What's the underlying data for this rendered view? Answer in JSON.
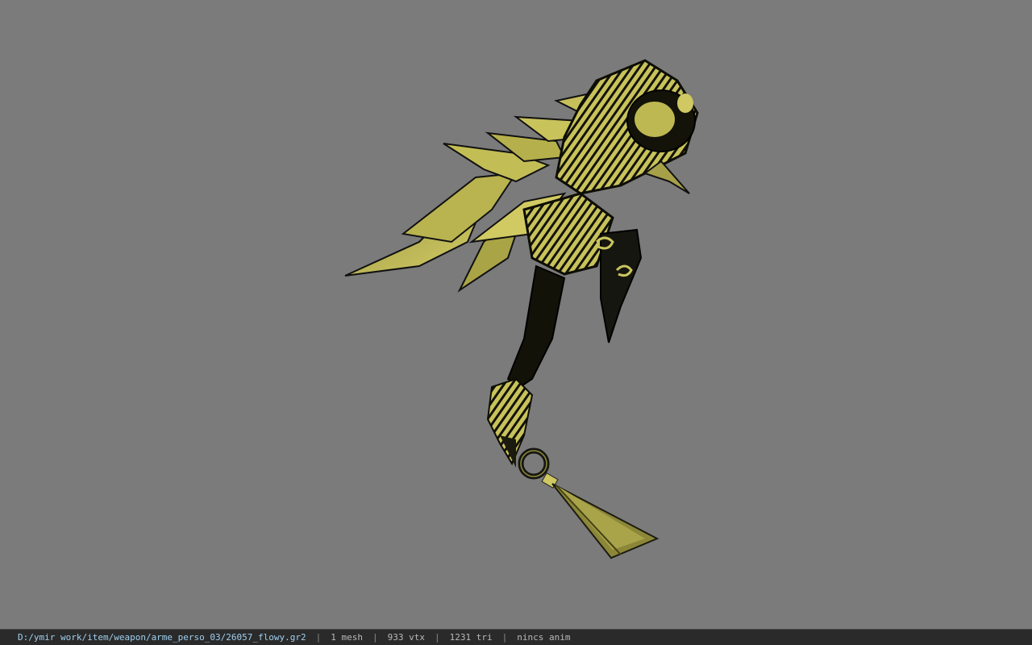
{
  "viewport": {
    "background_color": "#7b7b7b",
    "model": {
      "description_icon": "weapon-model-icon",
      "primary_color": "#c8c25a",
      "dark_color": "#0d0d05"
    }
  },
  "status_bar": {
    "file_path": "D:/ymir work/item/weapon/arme_perso_03/26057_flowy.gr2",
    "mesh_count": "1 mesh",
    "vertex_count": "933 vtx",
    "triangle_count": "1231 tri",
    "animation": "nincs anim",
    "separator": "|"
  }
}
